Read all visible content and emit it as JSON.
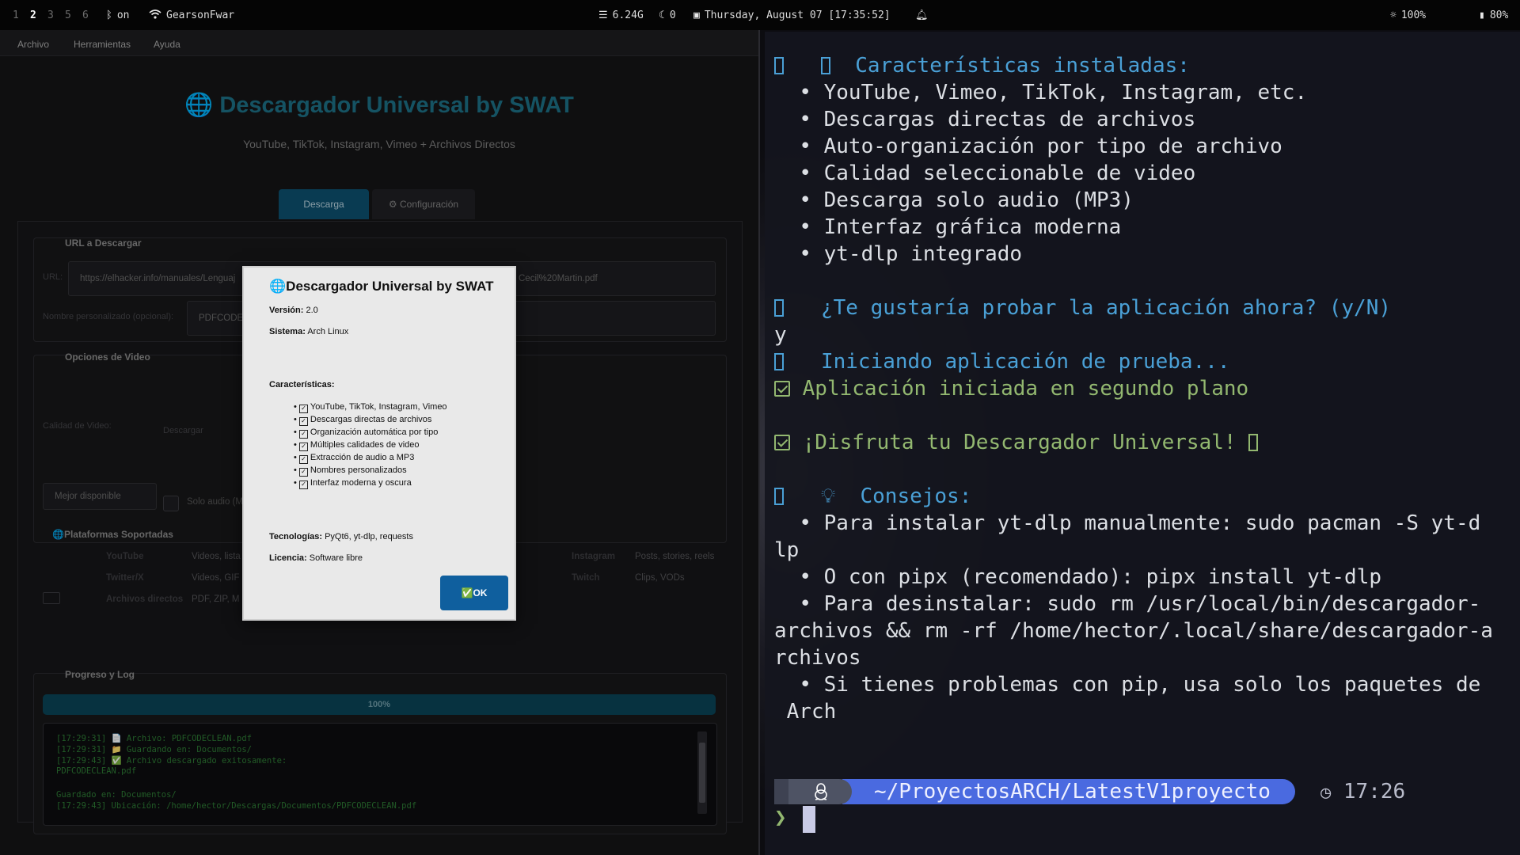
{
  "topbar": {
    "workspaces": [
      "1",
      "2",
      "3",
      "5",
      "6"
    ],
    "active_workspace": "2",
    "bluetooth": "on",
    "wifi": "GearsonFwar",
    "memory": "6.24G",
    "updates": "0",
    "datetime": "Thursday, August 07 [17:35:52]",
    "brightness": "100%",
    "battery": "80%"
  },
  "app": {
    "menu": [
      "Archivo",
      "Herramientas",
      "Ayuda"
    ],
    "title": "🌐 Descargador Universal by SWAT",
    "subtitle": "YouTube, TikTok, Instagram, Vimeo + Archivos Directos",
    "tabs": [
      "Descarga",
      "⚙ Configuración"
    ],
    "url_group": "URL a Descargar",
    "url_label": "URL:",
    "url_value_left": "https://elhacker.info/manuales/Lenguaj",
    "url_value_right": "Cecil%20Martin.pdf",
    "name_label": "Nombre personalizado (opcional):",
    "name_value": "PDFCODE",
    "video_group": "Opciones de Video",
    "quality_label": "Calidad de Video:",
    "quality_sub": "Descargar",
    "quality_value": "Mejor disponible",
    "audio_only": "Solo audio (M",
    "platforms_group": "🌐Plataformas Soportadas",
    "platforms": [
      {
        "name": "YouTube",
        "desc": "Videos, lista"
      },
      {
        "name": "Twitter/X",
        "desc": "Videos, GIF"
      },
      {
        "name": "Archivos directos",
        "desc": "PDF, ZIP, M"
      },
      {
        "name": "Instagram",
        "desc": "Posts, stories, reels"
      },
      {
        "name": "Twitch",
        "desc": "Clips, VODs"
      }
    ],
    "progress_group": "Progreso y Log",
    "progress_value": 100,
    "progress_text": "100%",
    "log": [
      "[17:29:31] 📄 Archivo: PDFCODECLEAN.pdf",
      "[17:29:31] 📁 Guardando en: Documentos/",
      "[17:29:43] ✅ Archivo descargado exitosamente:",
      "PDFCODECLEAN.pdf",
      "Guardado en: Documentos/",
      "[17:29:43]    Ubicación: /home/hector/Descargas/Documentos/PDFCODECLEAN.pdf"
    ]
  },
  "dialog": {
    "title": "🌐Descargador Universal by SWAT",
    "version_label": "Versión:",
    "version": "2.0",
    "system_label": "Sistema:",
    "system": "Arch Linux",
    "features_label": "Características:",
    "features": [
      "YouTube, TikTok, Instagram, Vimeo",
      "Descargas directas de archivos",
      "Organización automática por tipo",
      "Múltiples calidades de video",
      "Extracción de audio a MP3",
      "Nombres personalizados",
      "Interfaz moderna y oscura"
    ],
    "tech_label": "Tecnologías:",
    "tech": "PyQt6, yt-dlp, requests",
    "license_label": "Licencia:",
    "license": "Software libre",
    "ok": "✅OK"
  },
  "terminal": {
    "features_header": "Características instaladas:",
    "features": [
      "• YouTube, Vimeo, TikTok, Instagram, etc.",
      "• Descargas directas de archivos",
      "• Auto-organización por tipo de archivo",
      "• Calidad seleccionable de video",
      "• Descarga solo audio (MP3)",
      "• Interfaz gráfica moderna",
      "• yt-dlp integrado"
    ],
    "question": "¿Te gustaría probar la aplicación ahora? (y/N)",
    "answer": "y",
    "starting": "Iniciando aplicación de prueba...",
    "started": "Aplicación iniciada en segundo plano",
    "enjoy": "¡Disfruta tu Descargador Universal!",
    "tips_header": "Consejos:",
    "tips": [
      "• Para instalar yt-dlp manualmente: sudo pacman -S yt-d",
      "lp",
      "• O con pipx (recomendado): pipx install yt-dlp",
      "• Para desinstalar: sudo rm /usr/local/bin/descargador-",
      "archivos && rm -rf /home/hector/.local/share/descargador-a",
      "rchivos",
      "• Si tienes problemas con pip, usa solo los paquetes de",
      " Arch"
    ],
    "prompt_path": "~/ProyectosARCH/LatestV1proyecto",
    "prompt_time": "17:26",
    "caret": "❯"
  }
}
